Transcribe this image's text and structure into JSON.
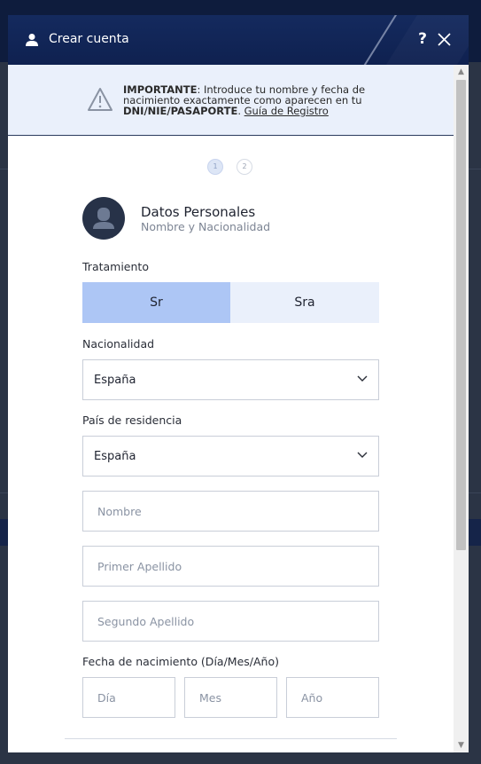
{
  "header": {
    "title": "Crear cuenta",
    "help_glyph": "?"
  },
  "notice": {
    "bold_prefix": "IMPORTANTE",
    "text": ": Introduce tu nombre y fecha de nacimiento exactamente como aparecen en tu ",
    "bold_doc": "DNI/NIE/PASAPORTE",
    "period": ". ",
    "link": "Guía de Registro"
  },
  "steps": [
    "1",
    "2"
  ],
  "section": {
    "title": "Datos Personales",
    "subtitle": "Nombre y Nacionalidad"
  },
  "tratamiento": {
    "label": "Tratamiento",
    "options": [
      "Sr",
      "Sra"
    ],
    "selected": "Sr"
  },
  "nacionalidad": {
    "label": "Nacionalidad",
    "value": "España"
  },
  "residencia": {
    "label": "País de residencia",
    "value": "España"
  },
  "inputs": {
    "nombre": "Nombre",
    "primer_apellido": "Primer Apellido",
    "segundo_apellido": "Segundo Apellido"
  },
  "fecha": {
    "label": "Fecha de nacimiento (Día/Mes/Año)",
    "dia": "Día",
    "mes": "Mes",
    "anio": "Año"
  },
  "colors": {
    "header_bg": "#0f2150",
    "accent_selected": "#adc6f5",
    "accent_light": "#eaf0fb"
  }
}
